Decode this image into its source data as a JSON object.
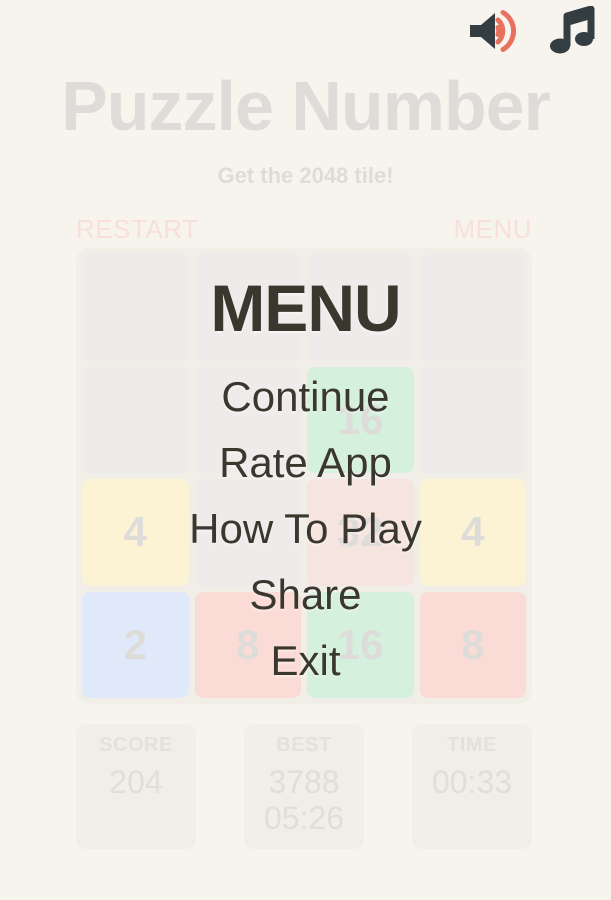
{
  "topbar": {
    "sound_icon": "speaker-on-icon",
    "music_icon": "music-note-icon",
    "sound_body_color": "#333d42",
    "sound_wave_color": "#e8705f",
    "music_color": "#333d42"
  },
  "header": {
    "title": "Puzzle Number",
    "subtitle": "Get the 2048 tile!",
    "title_color": "#dedcd9"
  },
  "controls": {
    "restart_label": "RESTART",
    "menu_label": "MENU",
    "color": "#f8dfda"
  },
  "board": {
    "rows": [
      [
        {
          "value": "",
          "kind": "empty"
        },
        {
          "value": "",
          "kind": "empty"
        },
        {
          "value": "",
          "kind": "empty"
        },
        {
          "value": "",
          "kind": "empty"
        }
      ],
      [
        {
          "value": "",
          "kind": "empty"
        },
        {
          "value": "",
          "kind": "empty"
        },
        {
          "value": "16",
          "kind": "t16"
        },
        {
          "value": "",
          "kind": "empty"
        }
      ],
      [
        {
          "value": "4",
          "kind": "t4"
        },
        {
          "value": "",
          "kind": "empty"
        },
        {
          "value": "32",
          "kind": "t32"
        },
        {
          "value": "4",
          "kind": "t4"
        }
      ],
      [
        {
          "value": "2",
          "kind": "t2"
        },
        {
          "value": "8",
          "kind": "t8"
        },
        {
          "value": "16",
          "kind": "t16"
        },
        {
          "value": "8",
          "kind": "t8"
        }
      ]
    ],
    "colors": {
      "board_bg": "#f1eee8",
      "empty": "#edecea",
      "t2": "#dfe9f9",
      "t4": "#fcf2d4",
      "t8": "#fbdbd5",
      "t16": "#d5f0dc",
      "t32": "#f6e5df",
      "tile_text": "#dedcd9"
    }
  },
  "stats": {
    "score": {
      "label": "SCORE",
      "value": "204"
    },
    "best": {
      "label": "BEST",
      "value": "3788\n05:26"
    },
    "time": {
      "label": "TIME",
      "value": "00:33"
    }
  },
  "menu": {
    "title": "MENU",
    "items": [
      {
        "label": "Continue"
      },
      {
        "label": "Rate App"
      },
      {
        "label": "How To Play"
      },
      {
        "label": "Share"
      },
      {
        "label": "Exit"
      }
    ],
    "text_color": "#3a372f"
  }
}
